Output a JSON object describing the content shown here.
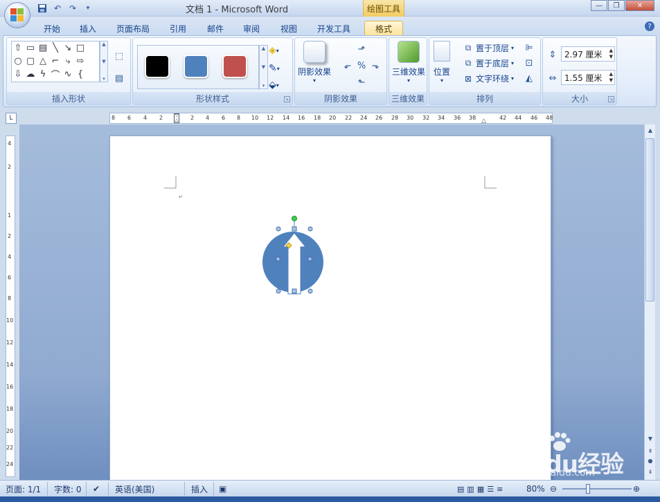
{
  "window": {
    "title": "文档 1 - Microsoft Word",
    "context_tool": "绘图工具",
    "minimize": "—",
    "restore": "❐",
    "close": "✕"
  },
  "qat": {
    "save_icon": "save-icon",
    "undo_icon": "undo-icon",
    "redo_icon": "redo-icon",
    "customize_icon": "dropdown-icon"
  },
  "tabs": [
    "开始",
    "插入",
    "页面布局",
    "引用",
    "邮件",
    "审阅",
    "视图",
    "开发工具",
    "格式"
  ],
  "active_tab": "格式",
  "ribbon": {
    "insert_shapes": {
      "label": "插入形状"
    },
    "shape_styles": {
      "label": "形状样式",
      "swatches": [
        "#000000",
        "#4f81bd",
        "#c0504d"
      ]
    },
    "shadow": {
      "label": "阴影效果",
      "button": "阴影效果"
    },
    "threed": {
      "label": "三维效果",
      "button": "三维效果"
    },
    "arrange": {
      "label": "排列",
      "position": "位置",
      "bring_front": "置于顶层",
      "send_back": "置于底层",
      "text_wrap": "文字环绕"
    },
    "size": {
      "label": "大小",
      "height": "2.97 厘米",
      "width": "1.55 厘米"
    }
  },
  "ruler": {
    "h_left": [
      "8",
      "6",
      "4",
      "2"
    ],
    "h_right": [
      "2",
      "4",
      "6",
      "8",
      "10",
      "12",
      "14",
      "16",
      "18",
      "20",
      "22",
      "24",
      "26",
      "28",
      "30",
      "32",
      "34",
      "36",
      "38",
      "42",
      "44",
      "46",
      "48"
    ],
    "v": [
      "4",
      "2",
      "1",
      "2",
      "4",
      "6",
      "8",
      "10",
      "12",
      "14",
      "16",
      "18",
      "20",
      "22",
      "24"
    ]
  },
  "document": {
    "shape": {
      "circle_color": "#4f81bd",
      "arrow_color": "#ffffff"
    }
  },
  "statusbar": {
    "page": "页面: 1/1",
    "words": "字数: 0",
    "language": "英语(美国)",
    "mode": "插入",
    "zoom": "80%"
  },
  "watermark": {
    "brand": "Baidu经验",
    "url": "jingyan.baidu.com"
  }
}
